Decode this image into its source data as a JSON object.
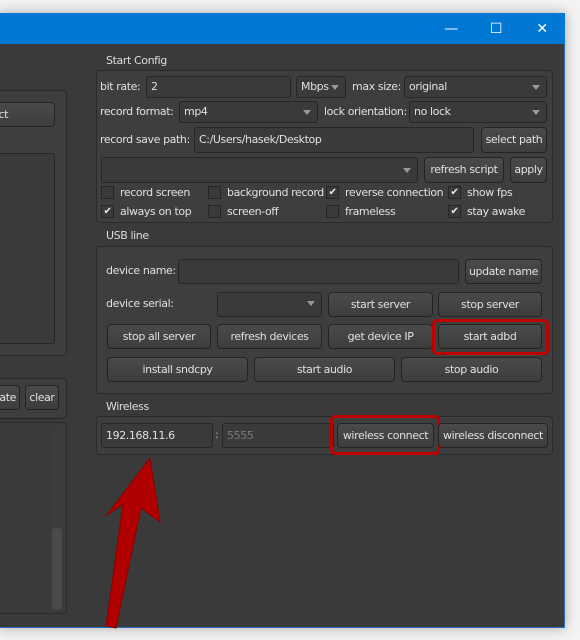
{
  "window": {
    "controls": {
      "minimize": "—",
      "maximize": "☐",
      "close": "✕"
    }
  },
  "left": {
    "button_partial": "ct",
    "update_partial": "ate",
    "clear": "clear"
  },
  "start_config": {
    "title": "Start Config",
    "bit_rate_label": "bit rate:",
    "bit_rate": "2",
    "unit": "Mbps",
    "max_size_label": "max size:",
    "max_size": "original",
    "record_format_label": "record format:",
    "record_format": "mp4",
    "lock_orientation_label": "lock orientation:",
    "lock_orientation": "no lock",
    "save_path_label": "record save path:",
    "save_path": "C:/Users/hasek/Desktop",
    "select_path": "select path",
    "refresh_script": "refresh script",
    "apply": "apply",
    "checkboxes": [
      {
        "label": "record screen",
        "checked": false
      },
      {
        "label": "background record",
        "checked": false
      },
      {
        "label": "reverse connection",
        "checked": true
      },
      {
        "label": "show fps",
        "checked": true
      },
      {
        "label": "always on top",
        "checked": true
      },
      {
        "label": "screen-off",
        "checked": false
      },
      {
        "label": "frameless",
        "checked": false
      },
      {
        "label": "stay awake",
        "checked": true
      }
    ]
  },
  "usb": {
    "title": "USB line",
    "device_name_label": "device name:",
    "update_name": "update name",
    "device_serial_label": "device serial:",
    "start_server": "start server",
    "stop_server": "stop server",
    "stop_all_server": "stop all server",
    "refresh_devices": "refresh devices",
    "get_device_ip": "get device IP",
    "start_adbd": "start adbd",
    "install_sndcpy": "install sndcpy",
    "start_audio": "start audio",
    "stop_audio": "stop audio"
  },
  "wireless": {
    "title": "Wireless",
    "ip": "192.168.11.6",
    "sep": ":",
    "port_placeholder": "5555",
    "connect": "wireless connect",
    "disconnect": "wireless disconnect"
  },
  "colors": {
    "titlebar": "#0078d4",
    "highlight": "#c00000"
  }
}
